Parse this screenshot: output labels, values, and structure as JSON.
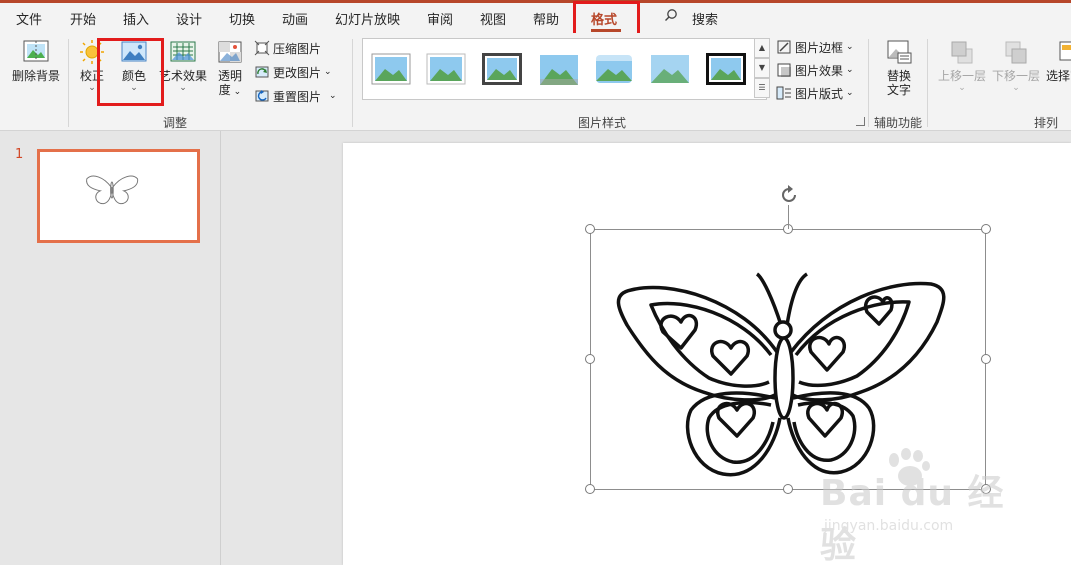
{
  "tabs": [
    {
      "label": "文件"
    },
    {
      "label": "开始"
    },
    {
      "label": "插入"
    },
    {
      "label": "设计"
    },
    {
      "label": "切换"
    },
    {
      "label": "动画"
    },
    {
      "label": "幻灯片放映"
    },
    {
      "label": "审阅"
    },
    {
      "label": "视图"
    },
    {
      "label": "帮助"
    },
    {
      "label": "格式"
    }
  ],
  "active_tab": "格式",
  "search_label": "搜索",
  "ribbon": {
    "remove_bg": "删除背景",
    "corrections": "校正",
    "color": "颜色",
    "artistic": "艺术效果",
    "transparency_line1": "透明",
    "transparency_line2": "度",
    "compress": "压缩图片",
    "change": "更改图片",
    "reset": "重置图片",
    "adjust_group": "调整",
    "picture_styles_group": "图片样式",
    "picture_border": "图片边框",
    "picture_effects": "图片效果",
    "picture_layout": "图片版式",
    "alt_text_line1": "替换",
    "alt_text_line2": "文字",
    "accessibility_group": "辅助功能",
    "bring_forward": "上移一层",
    "send_backward": "下移一层",
    "selection_pane": "选择窗",
    "arrange_group": "排列"
  },
  "slides": [
    {
      "number": "1"
    }
  ],
  "watermark": {
    "line1": "Bai du 经验",
    "line2": "jingyan.baidu.com"
  },
  "colors": {
    "accent": "#b7472a",
    "highlight_box": "#e21b1b",
    "thumb_border": "#e4704a"
  }
}
